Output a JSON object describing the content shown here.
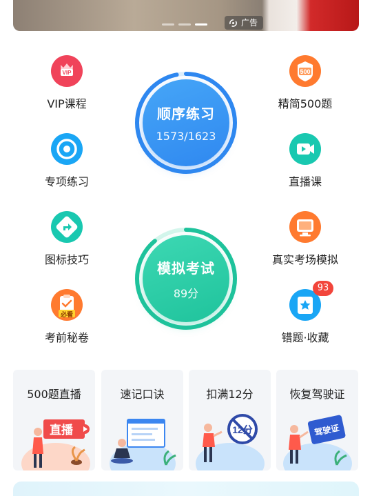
{
  "banner": {
    "ad_label": "广告",
    "slide_count": 3,
    "active_slide": 3
  },
  "grid": {
    "vip": {
      "label": "VIP课程",
      "icon": "vip-crown-icon",
      "color": "#f0435a",
      "icon_text": "VIP"
    },
    "concise": {
      "label": "精简500题",
      "icon": "500-badge-icon",
      "color": "#ff7a2f",
      "icon_text": "500"
    },
    "special": {
      "label": "专项练习",
      "icon": "target-icon",
      "color": "#1aa6f5"
    },
    "live": {
      "label": "直播课",
      "icon": "video-play-icon",
      "color": "#19c8b0"
    },
    "sign_tips": {
      "label": "图标技巧",
      "icon": "road-sign-icon",
      "color": "#19c8b0"
    },
    "real_exam": {
      "label": "真实考场模拟",
      "icon": "monitor-icon",
      "color": "#ff7a2f"
    },
    "secret": {
      "label": "考前秘卷",
      "icon": "clipboard-icon",
      "color": "#ff7a2f",
      "tag": "必看"
    },
    "mistakes": {
      "label": "错题·收藏",
      "icon": "star-folder-icon",
      "color": "#1aa6f5",
      "badge": "93"
    }
  },
  "practice": {
    "title": "顺序练习",
    "progress_text": "1573/1623",
    "done": 1573,
    "total": 1623,
    "color": "#2f88f0"
  },
  "mock": {
    "title": "模拟考试",
    "score_text": "89分",
    "score": 89,
    "color": "#1fc39c"
  },
  "cards": [
    {
      "title": "500题直播",
      "art_text": "直播"
    },
    {
      "title": "速记口诀",
      "art_text": ""
    },
    {
      "title": "扣满12分",
      "art_text": "12分"
    },
    {
      "title": "恢复驾驶证",
      "art_text": "驾驶证"
    }
  ]
}
